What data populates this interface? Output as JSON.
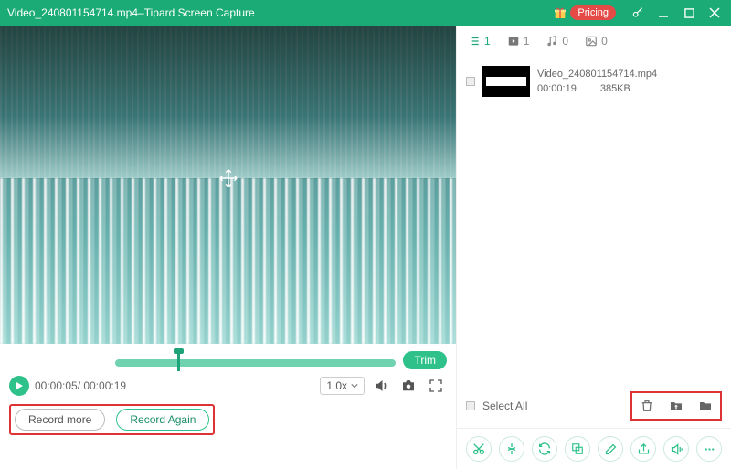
{
  "titlebar": {
    "filename": "Video_240801154714.mp4",
    "sep": "  –  ",
    "app": "Tipard Screen Capture",
    "pricing": "Pricing"
  },
  "player": {
    "current_time": "00:00:05",
    "total_time": "00:00:19",
    "time_display": "00:00:05/ 00:00:19",
    "speed": "1.0x",
    "trim_label": "Trim"
  },
  "buttons": {
    "record_more": "Record more",
    "record_again": "Record Again"
  },
  "tabs": {
    "list_count": "1",
    "video_count": "1",
    "audio_count": "0",
    "image_count": "0"
  },
  "file": {
    "name": "Video_240801154714.mp4",
    "duration": "00:00:19",
    "size": "385KB"
  },
  "select_all": "Select All"
}
